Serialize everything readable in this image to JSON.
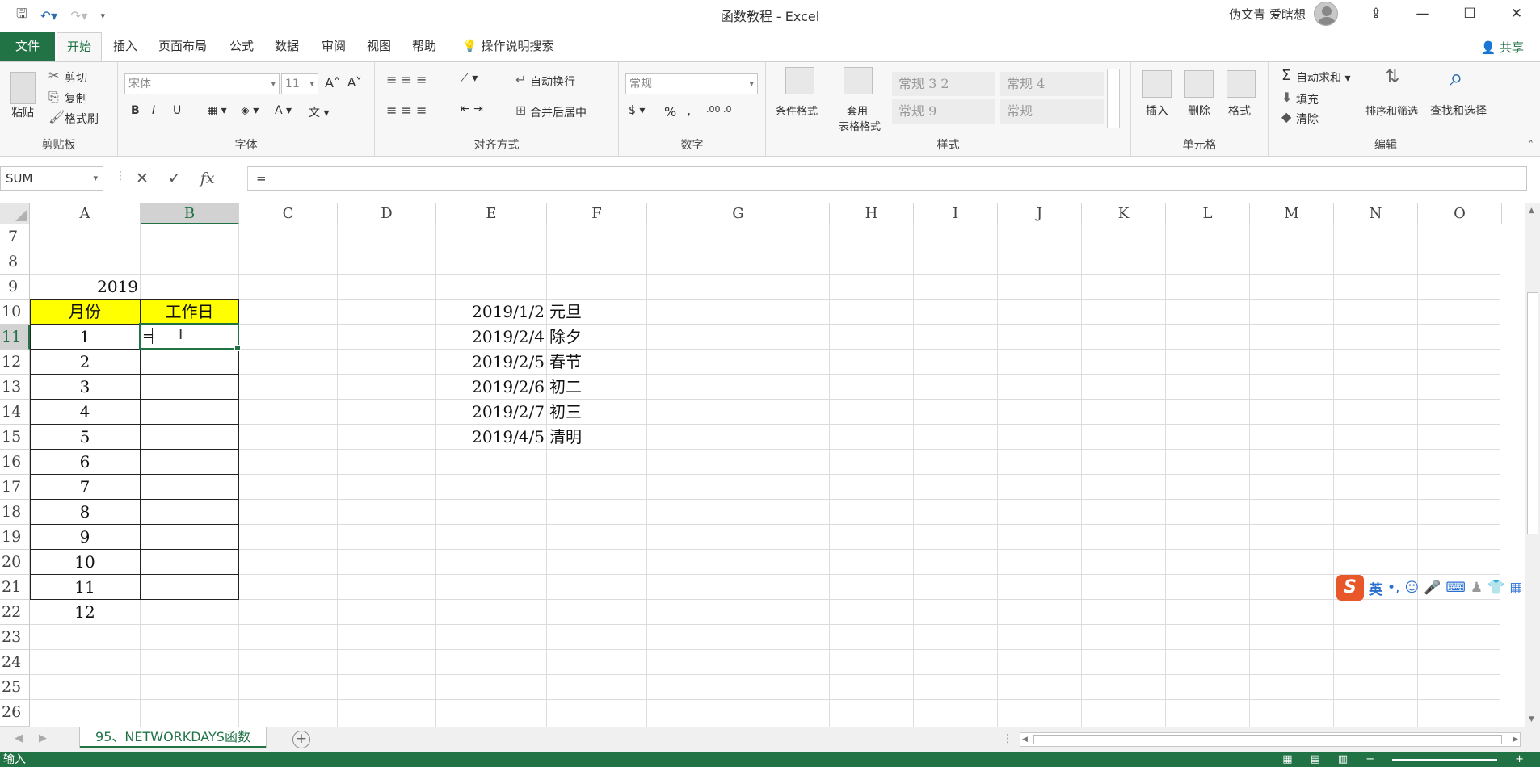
{
  "window": {
    "title": "函数教程  -  Excel",
    "user": "伪文青 爱瞎想",
    "minimize": "—",
    "maximize": "☐",
    "close": "✕",
    "ribbon_display": "⇪"
  },
  "tabs": {
    "file": "文件",
    "items": [
      "开始",
      "插入",
      "页面布局",
      "公式",
      "数据",
      "审阅",
      "视图",
      "帮助"
    ],
    "search": "操作说明搜索",
    "share": "共享"
  },
  "ribbon": {
    "clipboard": {
      "label": "剪贴板",
      "paste": "粘贴",
      "cut": "剪切",
      "copy": "复制",
      "format_painter": "格式刷"
    },
    "font": {
      "label": "字体",
      "font_name": "宋体",
      "font_size": "11",
      "bold": "B",
      "italic": "I",
      "underline": "U"
    },
    "alignment": {
      "label": "对齐方式",
      "wrap": "自动换行",
      "merge": "合并后居中"
    },
    "number": {
      "label": "数字",
      "format": "常规",
      "percent": "%",
      "comma": ","
    },
    "styles": {
      "label": "样式",
      "conditional": "条件格式",
      "table_format_1": "套用",
      "table_format_2": "表格格式",
      "gallery": [
        "常规 3 2",
        "常规 4",
        "常规 9",
        "常规"
      ]
    },
    "cells": {
      "label": "单元格",
      "insert": "插入",
      "delete": "删除",
      "format": "格式"
    },
    "editing": {
      "label": "编辑",
      "autosum": "自动求和",
      "fill": "填充",
      "clear": "清除",
      "sort_filter": "排序和筛选",
      "find_select": "查找和选择"
    }
  },
  "formula_bar": {
    "name_box": "SUM",
    "cancel": "✕",
    "enter": "✓",
    "fx": "fx",
    "content": "="
  },
  "columns": [
    "A",
    "B",
    "C",
    "D",
    "E",
    "F",
    "G",
    "H",
    "I",
    "J",
    "K",
    "L",
    "M",
    "N",
    "O"
  ],
  "rows": [
    "7",
    "8",
    "9",
    "10",
    "11",
    "12",
    "13",
    "14",
    "15",
    "16",
    "17",
    "18",
    "19",
    "20",
    "21",
    "22",
    "23",
    "24",
    "25",
    "26"
  ],
  "sheet": {
    "year": "2019",
    "header_month": "月份",
    "header_workdays": "工作日",
    "months": [
      "1",
      "2",
      "3",
      "4",
      "5",
      "6",
      "7",
      "8",
      "9",
      "10",
      "11",
      "12"
    ],
    "editing_value": "=",
    "holidays": [
      {
        "date": "2019/1/2",
        "name": "元旦"
      },
      {
        "date": "2019/2/4",
        "name": "除夕"
      },
      {
        "date": "2019/2/5",
        "name": "春节"
      },
      {
        "date": "2019/2/6",
        "name": "初二"
      },
      {
        "date": "2019/2/7",
        "name": "初三"
      },
      {
        "date": "2019/4/5",
        "name": "清明"
      }
    ]
  },
  "sheet_tabs": {
    "active": "95、NETWORKDAYS函数",
    "add": "+"
  },
  "status": {
    "mode": "输入",
    "zoom_minus": "−",
    "zoom_plus": "+"
  },
  "ime": {
    "lang": "英"
  }
}
